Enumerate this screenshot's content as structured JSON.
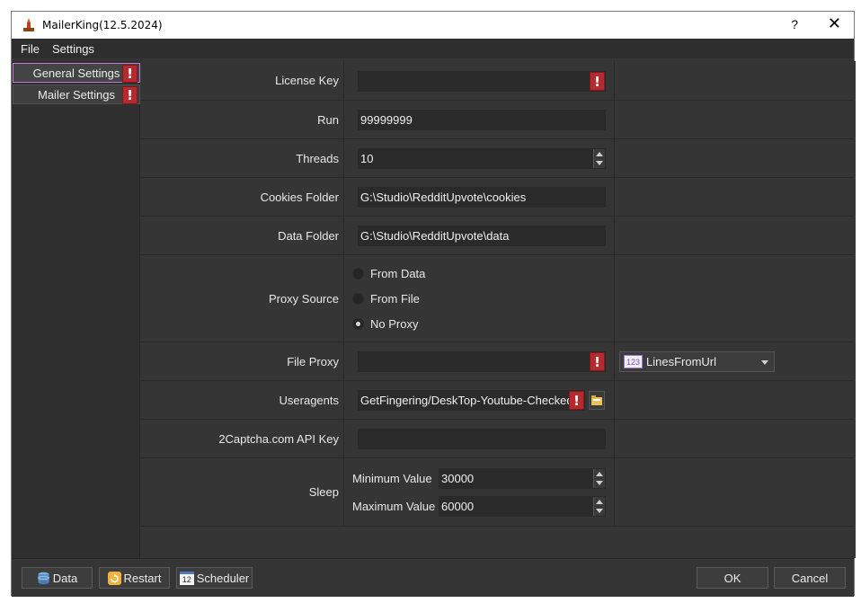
{
  "window": {
    "title": "MailerKing(12.5.2024)",
    "help_glyph": "?",
    "close_glyph": "✕"
  },
  "menu": [
    "File",
    "Settings"
  ],
  "sidebar": {
    "items": [
      {
        "label": "General Settings",
        "warning": "!"
      },
      {
        "label": "Mailer Settings",
        "warning": "!"
      }
    ]
  },
  "form": {
    "license_key": {
      "label": "License Key",
      "value": "",
      "warning": "!"
    },
    "run": {
      "label": "Run",
      "value": "99999999"
    },
    "threads": {
      "label": "Threads",
      "value": "10"
    },
    "cookies_folder": {
      "label": "Cookies Folder",
      "value": "G:\\Studio\\RedditUpvote\\cookies"
    },
    "data_folder": {
      "label": "Data Folder",
      "value": "G:\\Studio\\RedditUpvote\\data"
    },
    "proxy_source": {
      "label": "Proxy Source",
      "options": [
        "From Data",
        "From File",
        "No Proxy"
      ],
      "selected": "No Proxy"
    },
    "file_proxy": {
      "label": "File Proxy",
      "value": "",
      "warning": "!",
      "mode_badge": "123",
      "mode": "LinesFromUrl"
    },
    "useragents": {
      "label": "Useragents",
      "value": "GetFingering/DeskTop-Youtube-Checked.",
      "warning": "!"
    },
    "captcha_key": {
      "label": "2Captcha.com API Key",
      "value": ""
    },
    "sleep": {
      "label": "Sleep",
      "min_label": "Minimum Value",
      "min_value": "30000",
      "max_label": "Maximum Value",
      "max_value": "60000"
    }
  },
  "footer": {
    "data_label": "Data",
    "restart_label": "Restart",
    "scheduler_label": "Scheduler",
    "scheduler_icon_text": "12",
    "ok_label": "OK",
    "cancel_label": "Cancel"
  },
  "colors": {
    "background": "#353535",
    "field": "#2a2a2a",
    "warning": "#b52a2f",
    "active_border": "#c17ad8"
  }
}
